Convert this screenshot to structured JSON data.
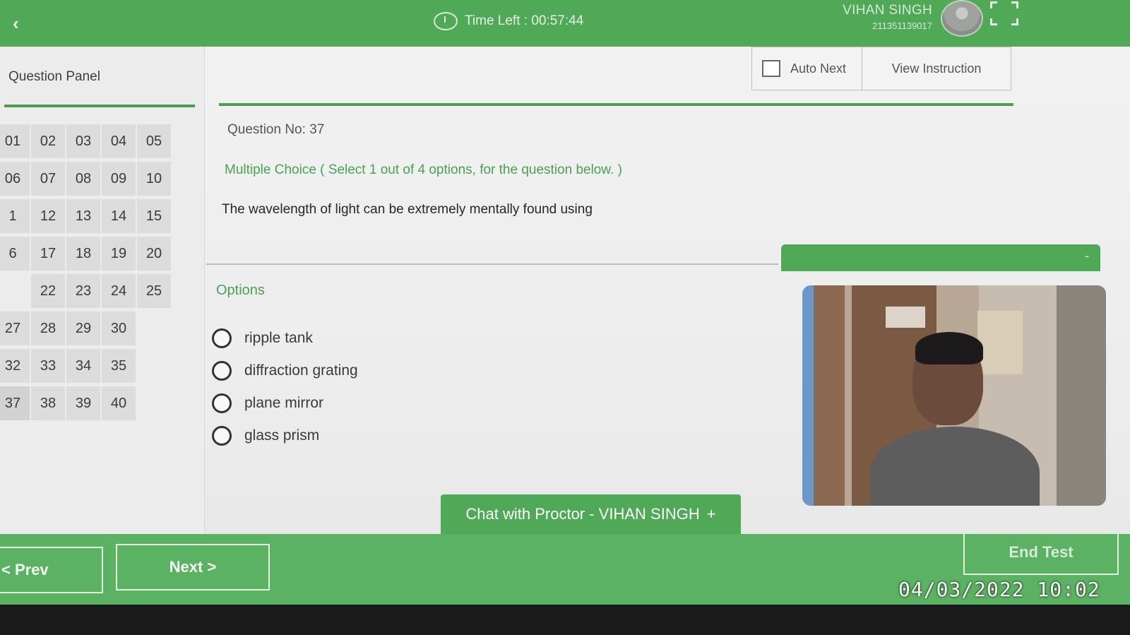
{
  "header": {
    "back_icon": "chevron-left-icon",
    "timer_icon": "stopwatch-icon",
    "timer_text": "Time Left :  00:57:44",
    "user_name": "VIHAN SINGH",
    "user_id": "211351139017",
    "fullscreen_icon": "fullscreen-icon"
  },
  "question_panel": {
    "title": "Question Panel",
    "numbers": [
      "01",
      "02",
      "03",
      "04",
      "05",
      "06",
      "07",
      "08",
      "09",
      "10",
      "1",
      "12",
      "13",
      "14",
      "15",
      "6",
      "17",
      "18",
      "19",
      "20",
      "",
      "22",
      "23",
      "24",
      "25",
      "27",
      "28",
      "29",
      "30",
      "",
      "32",
      "33",
      "34",
      "35",
      "",
      "37",
      "38",
      "39",
      "40",
      ""
    ],
    "current": "37"
  },
  "toolbar": {
    "auto_next_label": "Auto Next",
    "view_instruction_label": "View Instruction"
  },
  "question": {
    "number_label": "Question No: 37",
    "type_label": "Multiple Choice ( Select 1 out of 4 options, for the question below. )",
    "text": "The wavelength of light can be extremely mentally found using"
  },
  "options": {
    "label": "Options",
    "items": [
      "ripple tank",
      "diffraction grating",
      "plane mirror",
      "glass prism"
    ]
  },
  "proctor": {
    "minimize_label": "-"
  },
  "chat": {
    "label": "Chat with Proctor - VIHAN SINGH",
    "plus": "+"
  },
  "navigation": {
    "prev_label": "< Prev",
    "next_label": "Next >",
    "end_label": "End Test"
  },
  "timestamp": "04/03/2022 10:02",
  "colors": {
    "accent": "#4fa957",
    "panel_bg": "#ececec"
  }
}
